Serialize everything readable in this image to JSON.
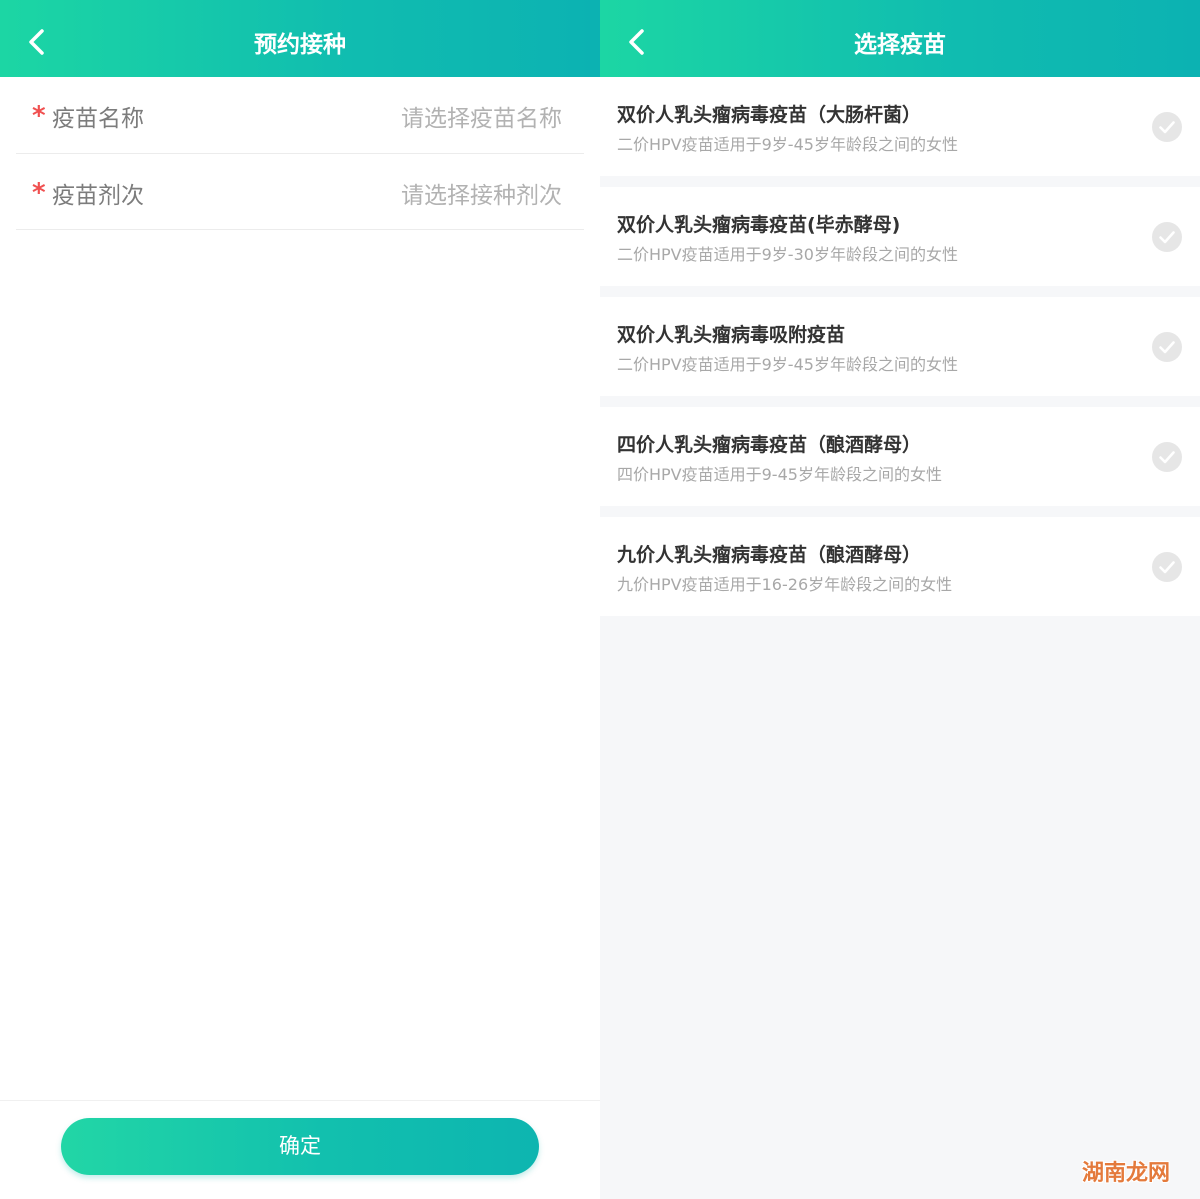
{
  "left_screen": {
    "title": "预约接种",
    "form": {
      "rows": [
        {
          "required_mark": "*",
          "label": "疫苗名称",
          "placeholder": "请选择疫苗名称"
        },
        {
          "required_mark": "*",
          "label": "疫苗剂次",
          "placeholder": "请选择接种剂次"
        }
      ]
    },
    "confirm_label": "确定"
  },
  "right_screen": {
    "title": "选择疫苗",
    "vaccines": [
      {
        "name": "双价人乳头瘤病毒疫苗（大肠杆菌）",
        "desc": "二价HPV疫苗适用于9岁-45岁年龄段之间的女性",
        "selected": false
      },
      {
        "name": "双价人乳头瘤病毒疫苗(毕赤酵母)",
        "desc": "二价HPV疫苗适用于9岁-30岁年龄段之间的女性",
        "selected": false
      },
      {
        "name": "双价人乳头瘤病毒吸附疫苗",
        "desc": "二价HPV疫苗适用于9岁-45岁年龄段之间的女性",
        "selected": false
      },
      {
        "name": "四价人乳头瘤病毒疫苗（酿酒酵母）",
        "desc": "四价HPV疫苗适用于9-45岁年龄段之间的女性",
        "selected": false
      },
      {
        "name": "九价人乳头瘤病毒疫苗（酿酒酵母）",
        "desc": "九价HPV疫苗适用于16-26岁年龄段之间的女性",
        "selected": false
      }
    ]
  },
  "watermark": "湖南龙网",
  "colors": {
    "accent_start": "#1cd6a4",
    "accent_end": "#0cb2b2",
    "required": "#f05050",
    "check_unselected": "#e6e6e6"
  },
  "icons": {
    "back": "chevron-left-icon",
    "check": "check-circle-icon"
  }
}
